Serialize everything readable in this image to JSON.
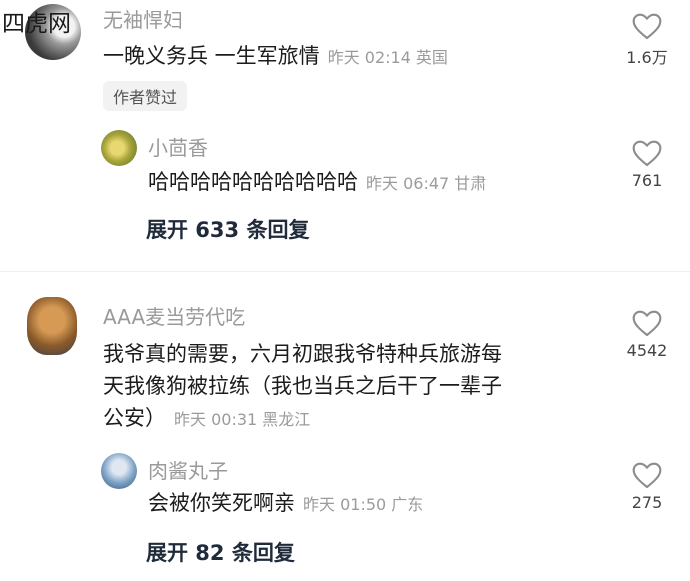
{
  "watermark": "四虎网",
  "comments": [
    {
      "user": "无袖悍妇",
      "text": "一晚义务兵 一生军旅情",
      "time": "昨天 02:14",
      "location": "英国",
      "badge": "作者赞过",
      "likes": "1.6万",
      "reply": {
        "user": "小茴香",
        "text": "哈哈哈哈哈哈哈哈哈哈",
        "time": "昨天 06:47",
        "location": "甘肃",
        "likes": "761"
      },
      "expand_label": "展开 633 条回复"
    },
    {
      "user": "AAA麦当劳代吃",
      "text_lines": [
        "我爷真的需要，六月初跟我爷特种兵旅游每",
        "天我像狗被拉练（我也当兵之后干了一辈子",
        "公安）"
      ],
      "time": "昨天 00:31",
      "location": "黑龙江",
      "likes": "4542",
      "reply": {
        "user": "肉酱丸子",
        "text": "会被你笑死啊亲",
        "time": "昨天 01:50",
        "location": "广东",
        "likes": "275"
      },
      "expand_label": "展开 82 条回复"
    }
  ]
}
